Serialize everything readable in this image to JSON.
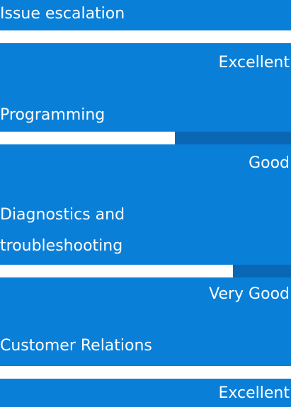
{
  "colors": {
    "background": "#0a7fd8",
    "track": "#0a67b4",
    "fill": "#ffffff",
    "text": "#ffffff"
  },
  "skills": [
    {
      "name": "Issue escalation",
      "rating": "Excellent",
      "level": 1.0
    },
    {
      "name": "Programming",
      "rating": "Good",
      "level": 0.6
    },
    {
      "name": "Diagnostics and troubleshooting",
      "rating": "Very Good",
      "level": 0.8
    },
    {
      "name": "Customer Relations",
      "rating": "Excellent",
      "level": 1.0
    }
  ]
}
